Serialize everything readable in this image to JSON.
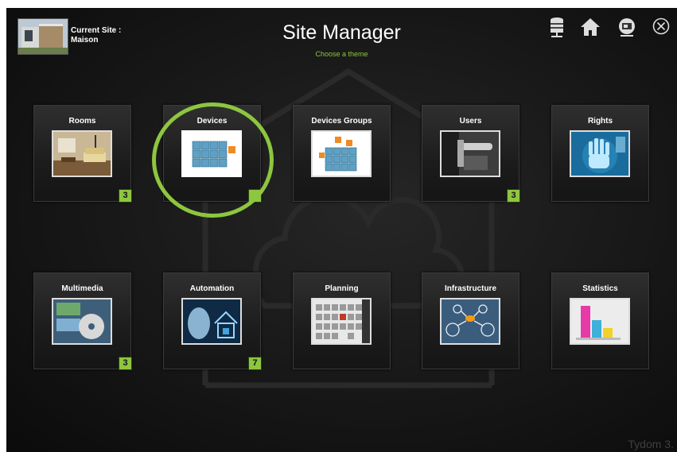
{
  "header": {
    "site_label": "Current Site :",
    "site_name": "Maison",
    "title": "Site Manager",
    "subtitle": "Choose a theme"
  },
  "toolbar": [
    {
      "name": "database-icon"
    },
    {
      "name": "home-icon"
    },
    {
      "name": "gateway-icon"
    },
    {
      "name": "close-icon"
    }
  ],
  "tiles": [
    {
      "label": "Rooms",
      "badge": "3"
    },
    {
      "label": "Devices",
      "badge": "",
      "highlighted": true
    },
    {
      "label": "Devices Groups",
      "badge": ""
    },
    {
      "label": "Users",
      "badge": "3"
    },
    {
      "label": "Rights",
      "badge": ""
    },
    {
      "label": "Multimedia",
      "badge": "3"
    },
    {
      "label": "Automation",
      "badge": "7"
    },
    {
      "label": "Planning",
      "badge": ""
    },
    {
      "label": "Infrastructure",
      "badge": ""
    },
    {
      "label": "Statistics",
      "badge": ""
    }
  ],
  "watermark": "Tydom 3.",
  "colors": {
    "accent": "#8dc63f",
    "background": "#171717"
  }
}
